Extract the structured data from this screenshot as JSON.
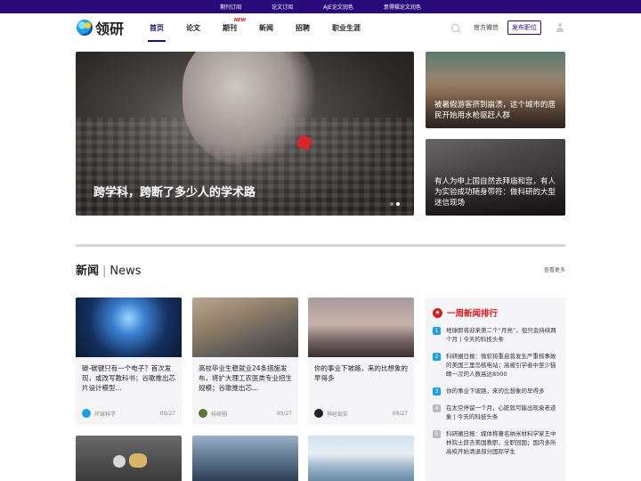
{
  "topbar": {
    "links": [
      "期刊订阅",
      "论文订阅",
      "AJE论文润色",
      "意得辑论文润色"
    ]
  },
  "header": {
    "logo_text": "领研",
    "nav": [
      {
        "label": "首页",
        "active": true
      },
      {
        "label": "论文",
        "active": false
      },
      {
        "label": "期刊",
        "active": false,
        "badge": "NEW"
      },
      {
        "label": "新闻",
        "active": false
      },
      {
        "label": "招聘",
        "active": false
      },
      {
        "label": "职业生涯",
        "active": false
      }
    ],
    "wechat": "官方微信",
    "post_button": "发布职位"
  },
  "hero": {
    "title": "跨学科，跨断了多少人的学术路"
  },
  "side_cards": [
    {
      "title": "被暑假游客挤到崩溃，这个城市的居民开始用水枪驱赶人群"
    },
    {
      "title": "有人为申上国自然去拜庙和宫，有人为实验成功随身带符：做科研的大型迷信现场"
    }
  ],
  "news_section": {
    "title": "新闻",
    "title_en": "News",
    "more": "查看更多"
  },
  "news_cards": [
    {
      "title": "碳-碳键只有一个电子？首次发现，或改写教科书；谷歌推出芯片设计模型...",
      "source": "环球科学",
      "date": "09/27"
    },
    {
      "title": "高校毕业生稳就业24条措施发布，将扩大理工农医类专业招生规模；谷歌推出芯...",
      "source": "科研圈",
      "date": "09/27"
    },
    {
      "title": "你的事业下坡路，来的比想象的早得多",
      "source": "神经现实",
      "date": "09/27"
    }
  ],
  "ranking": {
    "title": "一周新闻排行",
    "items": [
      {
        "num": "1",
        "text": "地球即将迎来第二个“月亮”，但只会持续两个月 | 今天的科技头条"
      },
      {
        "num": "2",
        "text": "科研圈日报：微软将重启曾发生严重核事故的美国三里岛核电站；高被引学者中至少猫睛一次的人数高达8000"
      },
      {
        "num": "3",
        "text": "你的事业下坡路，来的比想象的早得多"
      },
      {
        "num": "4",
        "text": "在太空停留一个月，心脏就可能出现衰老迹象 | 今天的科技头条"
      },
      {
        "num": "5",
        "text": "科研圈日报：媒体称著名纳米材料学家王中林院士辞去美国教职，全职回国；国内多所高校开始清退部分国际学生"
      }
    ]
  },
  "colors": {
    "brand": "#2a0a7a",
    "accent_red": "#d61b1b",
    "rank_blue": "#1aa0e8"
  }
}
